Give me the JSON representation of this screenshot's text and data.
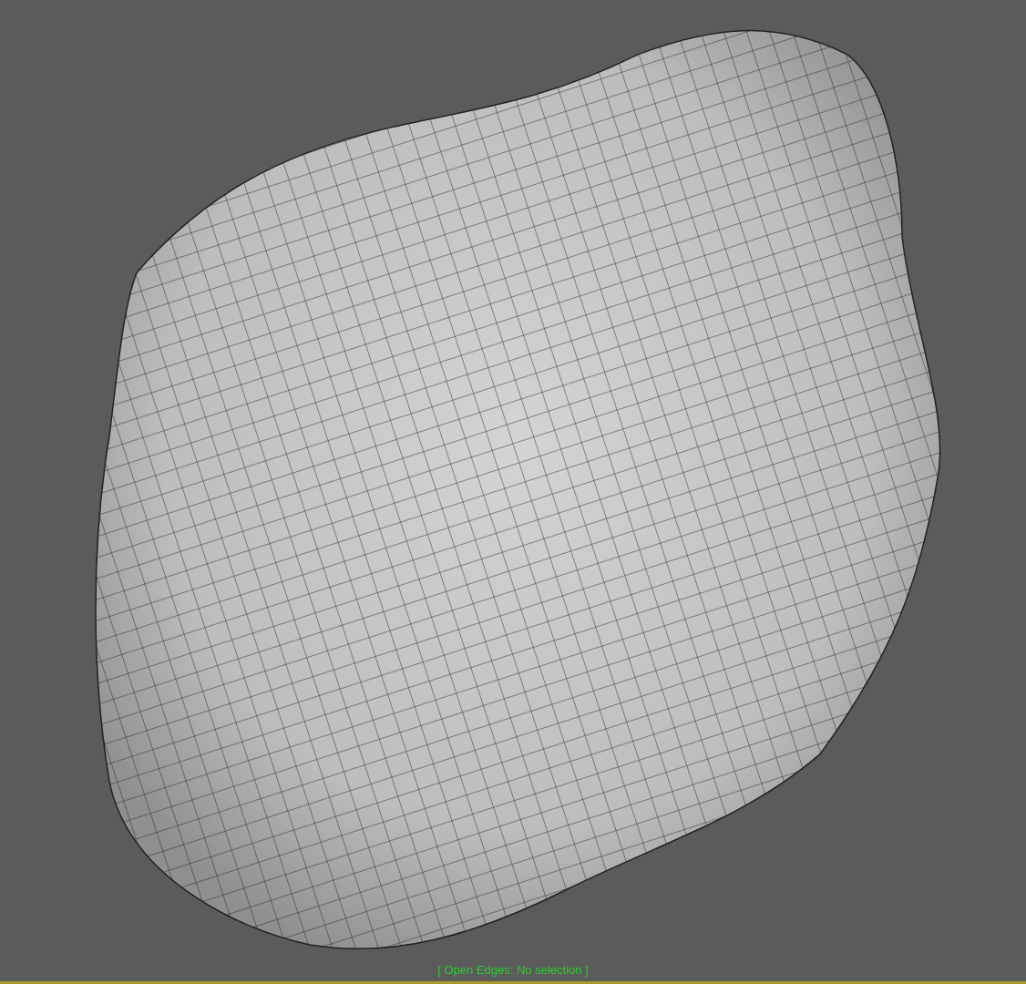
{
  "viewport": {
    "status_text": "[ Open Edges: No selection ]"
  }
}
